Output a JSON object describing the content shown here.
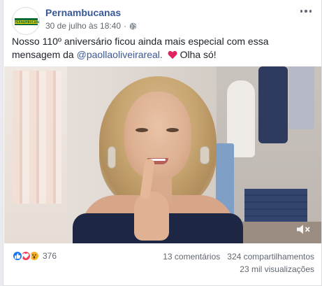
{
  "post": {
    "page_name": "Pernambucanas",
    "date": "30 de julho às 18:40",
    "separator": "·",
    "logo_text": "PERNAMBUCANAS",
    "message_line1": "Nosso 110º aniversário ficou ainda mais especial com essa mensagem da",
    "message_mention": "@paollaoliveirareal.",
    "message_after": "Olha só!"
  },
  "icons": {
    "privacy": "globe-icon",
    "menu": "more-icon",
    "emoji": "heart-icon",
    "volume": "speaker-muted-icon",
    "reactions": [
      "like-icon",
      "love-icon",
      "wow-icon"
    ]
  },
  "colors": {
    "brand_link": "#385898",
    "like": "#1877f2",
    "love": "#f33e58",
    "wow": "#f7b125",
    "heart": "#e0245e",
    "logo_green": "#0c6b35",
    "logo_yellow": "#f4d200"
  },
  "stats": {
    "reaction_count": "376",
    "comments": "13 comentários",
    "shares": "324 compartilhamentos",
    "views": "23 mil visualizações"
  }
}
